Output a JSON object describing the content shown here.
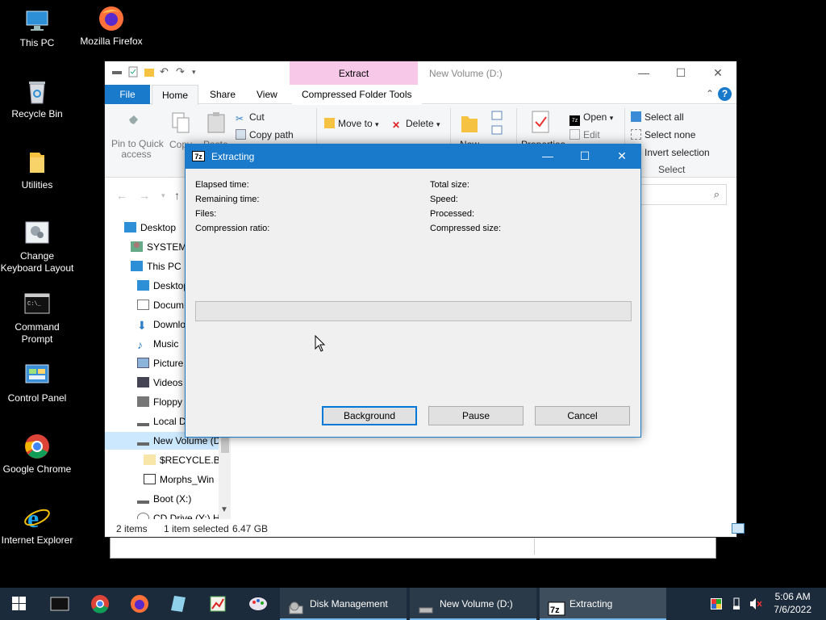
{
  "desktop": {
    "icons": [
      {
        "label": "This PC",
        "icon": "this-pc-icon"
      },
      {
        "label": "Mozilla Firefox",
        "icon": "firefox-icon"
      },
      {
        "label": "Recycle Bin",
        "icon": "recycle-bin-icon"
      },
      {
        "label": "Utilities",
        "icon": "folder-icon"
      },
      {
        "label": "Change Keyboard Layout",
        "icon": "keyboard-layout-icon"
      },
      {
        "label": "Command Prompt",
        "icon": "cmd-icon"
      },
      {
        "label": "Control Panel",
        "icon": "control-panel-icon"
      },
      {
        "label": "Google Chrome",
        "icon": "chrome-icon"
      },
      {
        "label": "Internet Explorer",
        "icon": "ie-icon"
      }
    ]
  },
  "explorer": {
    "title": "New Volume (D:)",
    "context_tab": "Extract",
    "tabs": {
      "file": "File",
      "home": "Home",
      "share": "Share",
      "view": "View",
      "compressed": "Compressed Folder Tools"
    },
    "ribbon": {
      "pin_line1": "Pin to Quick",
      "pin_line2": "access",
      "copy": "Copy",
      "paste": "Paste",
      "cut": "Cut",
      "copy_path": "Copy path",
      "move_to": "Move to",
      "delete": "Delete",
      "new": "New",
      "properties": "Properties",
      "open": "Open",
      "edit": "Edit",
      "select_all": "Select all",
      "select_none": "Select none",
      "invert_selection": "Invert selection",
      "select_group": "Select"
    },
    "nav": [
      {
        "label": "Desktop",
        "icon": "desktop-icon"
      },
      {
        "label": "SYSTEM",
        "icon": "user-icon"
      },
      {
        "label": "This PC",
        "icon": "this-pc-icon"
      },
      {
        "label": "Desktop",
        "icon": "desktop-icon"
      },
      {
        "label": "Docum",
        "icon": "documents-icon"
      },
      {
        "label": "Downlo",
        "icon": "downloads-icon"
      },
      {
        "label": "Music",
        "icon": "music-icon"
      },
      {
        "label": "Picture",
        "icon": "pictures-icon"
      },
      {
        "label": "Videos",
        "icon": "videos-icon"
      },
      {
        "label": "Floppy",
        "icon": "floppy-icon"
      },
      {
        "label": "Local D",
        "icon": "drive-icon"
      },
      {
        "label": "New Volume (D",
        "icon": "drive-icon"
      },
      {
        "label": "$RECYCLE.BIN",
        "icon": "folder-icon"
      },
      {
        "label": "Morphs_Win",
        "icon": "archive-icon"
      },
      {
        "label": "Boot (X:)",
        "icon": "drive-icon"
      },
      {
        "label": "CD Drive (Y:) H",
        "icon": "cd-drive-icon"
      }
    ],
    "status": {
      "items": "2 items",
      "selected": "1 item selected",
      "size": "6.47 GB"
    }
  },
  "dialog": {
    "title": "Extracting",
    "app_badge": "7z",
    "labels": {
      "elapsed": "Elapsed time:",
      "remaining": "Remaining time:",
      "files": "Files:",
      "ratio": "Compression ratio:",
      "total": "Total size:",
      "speed": "Speed:",
      "processed": "Processed:",
      "compressed": "Compressed size:"
    },
    "progress": 0,
    "buttons": {
      "background": "Background",
      "pause": "Pause",
      "cancel": "Cancel"
    }
  },
  "taskbar": {
    "tasks": [
      {
        "label": "Disk Management",
        "icon": "disk-management-icon"
      },
      {
        "label": "New Volume (D:)",
        "icon": "drive-icon"
      },
      {
        "label": "Extracting",
        "icon": "7zip-icon"
      }
    ],
    "clock": {
      "time": "5:06 AM",
      "date": "7/6/2022"
    }
  },
  "colors": {
    "accent": "#1979ca",
    "taskbar": "#1c2b3b",
    "extract_tab": "#f7c8e8"
  }
}
